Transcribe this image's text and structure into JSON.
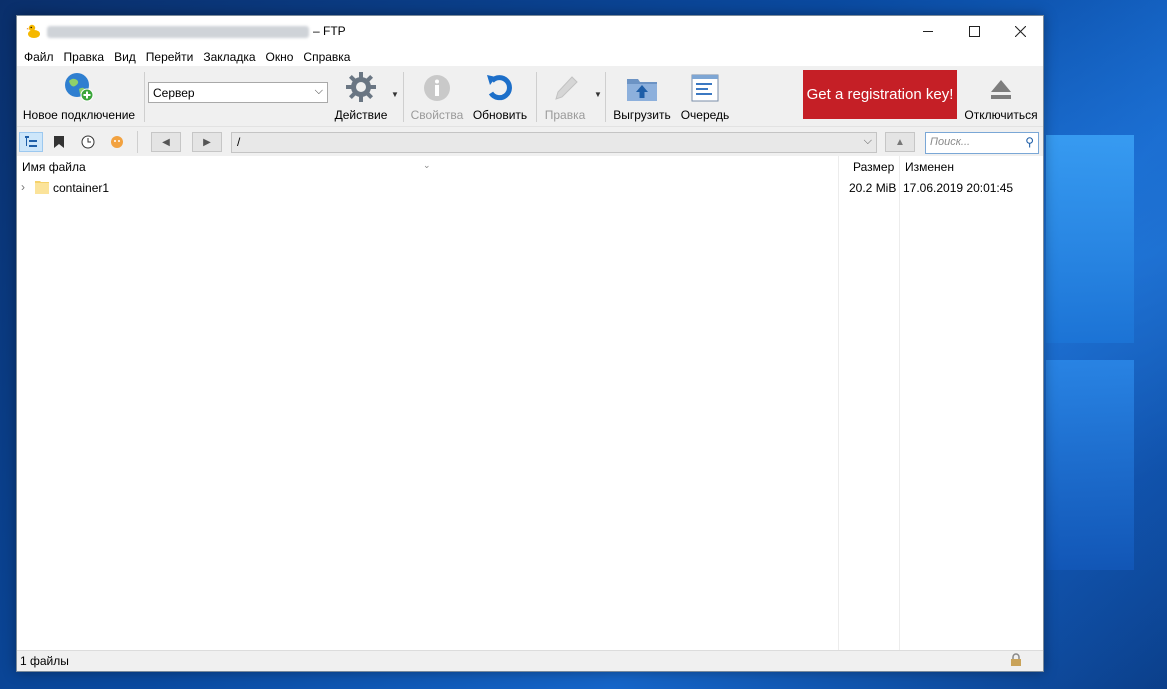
{
  "window": {
    "title_suffix": "– FTP"
  },
  "menu": [
    "Файл",
    "Правка",
    "Вид",
    "Перейти",
    "Закладка",
    "Окно",
    "Справка"
  ],
  "toolbar": {
    "new_connection": "Новое подключение",
    "server_value": "Сервер",
    "action": "Действие",
    "properties": "Свойства",
    "refresh": "Обновить",
    "edit": "Правка",
    "upload": "Выгрузить",
    "queue": "Очередь",
    "registration": "Get a registration key!",
    "disconnect": "Отключиться"
  },
  "navigation": {
    "path": "/",
    "search_placeholder": "Поиск..."
  },
  "file_list": {
    "columns": {
      "name": "Имя файла",
      "size": "Размер",
      "modified": "Изменен"
    },
    "rows": [
      {
        "name": "container1",
        "size": "20.2 MiB",
        "modified": "17.06.2019 20:01:45"
      }
    ]
  },
  "status": {
    "text": "1 файлы"
  },
  "colors": {
    "registration_bg": "#c51f26",
    "accent": "#0a4aa0"
  }
}
